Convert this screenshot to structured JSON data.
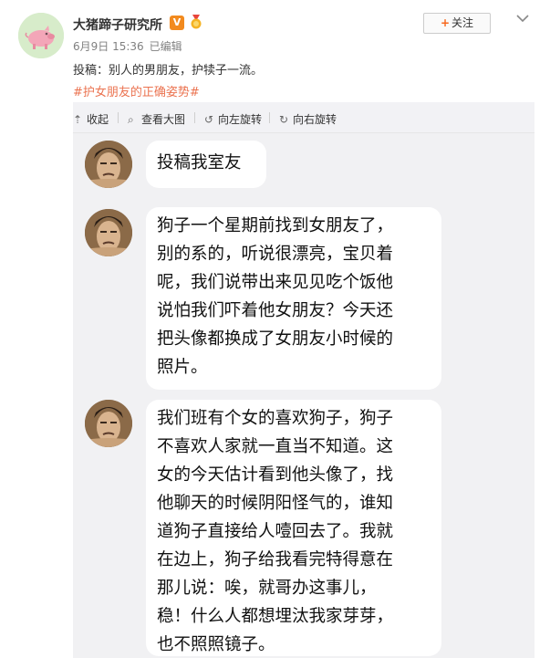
{
  "post": {
    "author": "大猪蹄子研究所",
    "verified_badge": "V",
    "date": "6月9日 15:36",
    "edited": "已编辑",
    "follow_label": "关注",
    "text": "投稿：别人的男朋友，护犊子一流。",
    "topic": "#护女朋友的正确姿势#"
  },
  "toolbar": {
    "collapse": "收起",
    "view_large": "查看大图",
    "rotate_left": "向左旋转",
    "rotate_right": "向右旋转"
  },
  "chat": {
    "messages": [
      {
        "lines": [
          "投稿我室友"
        ]
      },
      {
        "lines": [
          "狗子一个星期前找到女朋友了，",
          "别的系的，听说很漂亮，宝贝着",
          "呢，我们说带出来见见吃个饭他",
          "说怕我们吓着他女朋友？今天还",
          "把头像都换成了女朋友小时候的",
          "照片。"
        ]
      },
      {
        "lines": [
          "我们班有个女的喜欢狗子，狗子",
          "不喜欢人家就一直当不知道。这",
          "女的今天估计看到他头像了，找",
          "他聊天的时候阴阳怪气的，谁知",
          "道狗子直接给人噎回去了。我就",
          "在边上，狗子给我看完特得意在",
          "那儿说：唉，就哥办这事儿，",
          "稳！什么人都想埋汰我家芽芽，",
          "也不照照镜子。"
        ]
      }
    ]
  },
  "colors": {
    "topic": "#eb7350",
    "badge": "#f28a1e",
    "follow_plus": "#f7671d",
    "chat_bg": "#f1f1f3"
  },
  "icons": [
    "pig-avatar-icon",
    "medal-icon",
    "plus-icon",
    "chevron-down-icon",
    "collapse-icon",
    "zoom-icon",
    "rotate-left-icon",
    "rotate-right-icon"
  ]
}
